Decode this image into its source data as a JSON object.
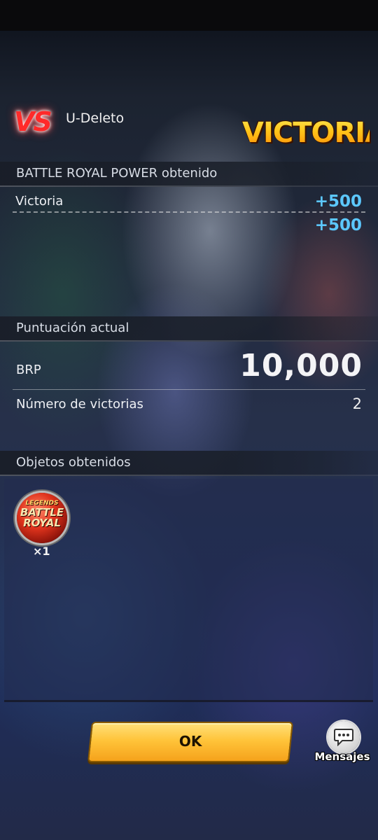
{
  "header": {
    "vs_label": "VS",
    "opponent_name": "U-Deleto",
    "result_banner": "VICTORIA"
  },
  "brp_section": {
    "title": "BATTLE ROYAL POWER obtenido",
    "rows": [
      {
        "label": "Victoria",
        "value": "+500"
      }
    ],
    "total": "+500"
  },
  "score_section": {
    "title": "Puntuación actual",
    "brp_label": "BRP",
    "brp_value": "10,000",
    "wins_label": "Número de victorias",
    "wins_value": "2"
  },
  "items_section": {
    "title": "Objetos obtenidos",
    "items": [
      {
        "name": "battle-royal-medal",
        "icon_text": [
          "LEGENDS",
          "BATTLE",
          "ROYAL"
        ],
        "quantity": "×1"
      }
    ]
  },
  "buttons": {
    "ok_label": "OK",
    "messages_label": "Mensajes"
  },
  "colors": {
    "accent_blue": "#5cc8ff",
    "ok_button": "#ffc43a",
    "vs_red": "#ff2a2a"
  }
}
